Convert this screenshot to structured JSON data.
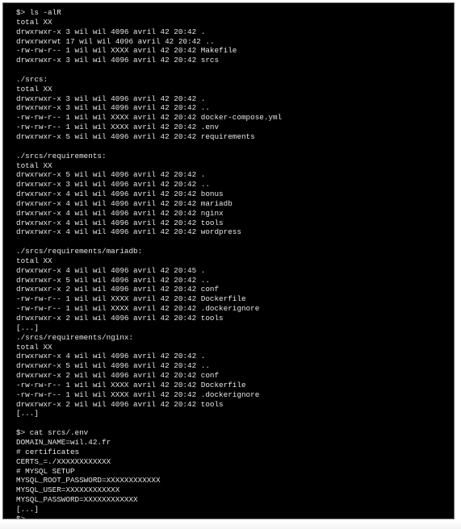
{
  "terminal": {
    "lines": [
      "$> ls -alR",
      "total XX",
      "drwxrwxr-x 3 wil wil 4096 avril 42 20:42 .",
      "drwxrwxrwt 17 wil wil 4096 avril 42 20:42 ..",
      "-rw-rw-r-- 1 wil wil XXXX avril 42 20:42 Makefile",
      "drwxrwxr-x 3 wil wil 4096 avril 42 20:42 srcs",
      "",
      "./srcs:",
      "total XX",
      "drwxrwxr-x 3 wil wil 4096 avril 42 20:42 .",
      "drwxrwxr-x 3 wil wil 4096 avril 42 20:42 ..",
      "-rw-rw-r-- 1 wil wil XXXX avril 42 20:42 docker-compose.yml",
      "-rw-rw-r-- 1 wil wil XXXX avril 42 20:42 .env",
      "drwxrwxr-x 5 wil wil 4096 avril 42 20:42 requirements",
      "",
      "./srcs/requirements:",
      "total XX",
      "drwxrwxr-x 5 wil wil 4096 avril 42 20:42 .",
      "drwxrwxr-x 3 wil wil 4096 avril 42 20:42 ..",
      "drwxrwxr-x 4 wil wil 4096 avril 42 20:42 bonus",
      "drwxrwxr-x 4 wil wil 4096 avril 42 20:42 mariadb",
      "drwxrwxr-x 4 wil wil 4096 avril 42 20:42 nginx",
      "drwxrwxr-x 4 wil wil 4096 avril 42 20:42 tools",
      "drwxrwxr-x 4 wil wil 4096 avril 42 20:42 wordpress",
      "",
      "./srcs/requirements/mariadb:",
      "total XX",
      "drwxrwxr-x 4 wil wil 4096 avril 42 20:45 .",
      "drwxrwxr-x 5 wil wil 4096 avril 42 20:42 ..",
      "drwxrwxr-x 2 wil wil 4096 avril 42 20:42 conf",
      "-rw-rw-r-- 1 wil wil XXXX avril 42 20:42 Dockerfile",
      "-rw-rw-r-- 1 wil wil XXXX avril 42 20:42 .dockerignore",
      "drwxrwxr-x 2 wil wil 4096 avril 42 20:42 tools",
      "[...]",
      "./srcs/requirements/nginx:",
      "total XX",
      "drwxrwxr-x 4 wil wil 4096 avril 42 20:42 .",
      "drwxrwxr-x 5 wil wil 4096 avril 42 20:42 ..",
      "drwxrwxr-x 2 wil wil 4096 avril 42 20:42 conf",
      "-rw-rw-r-- 1 wil wil XXXX avril 42 20:42 Dockerfile",
      "-rw-rw-r-- 1 wil wil XXXX avril 42 20:42 .dockerignore",
      "drwxrwxr-x 2 wil wil 4096 avril 42 20:42 tools",
      "[...]",
      "",
      "$> cat srcs/.env",
      "DOMAIN_NAME=wil.42.fr",
      "# certificates",
      "CERTS_=./XXXXXXXXXXXX",
      "# MYSQL SETUP",
      "MYSQL_ROOT_PASSWORD=XXXXXXXXXXXX",
      "MYSQL_USER=XXXXXXXXXXXX",
      "MYSQL_PASSWORD=XXXXXXXXXXXX",
      "[...]",
      "$>"
    ]
  },
  "colors": {
    "background": "#000000",
    "text": "#e6e6e6",
    "border": "#6a6a6a"
  }
}
